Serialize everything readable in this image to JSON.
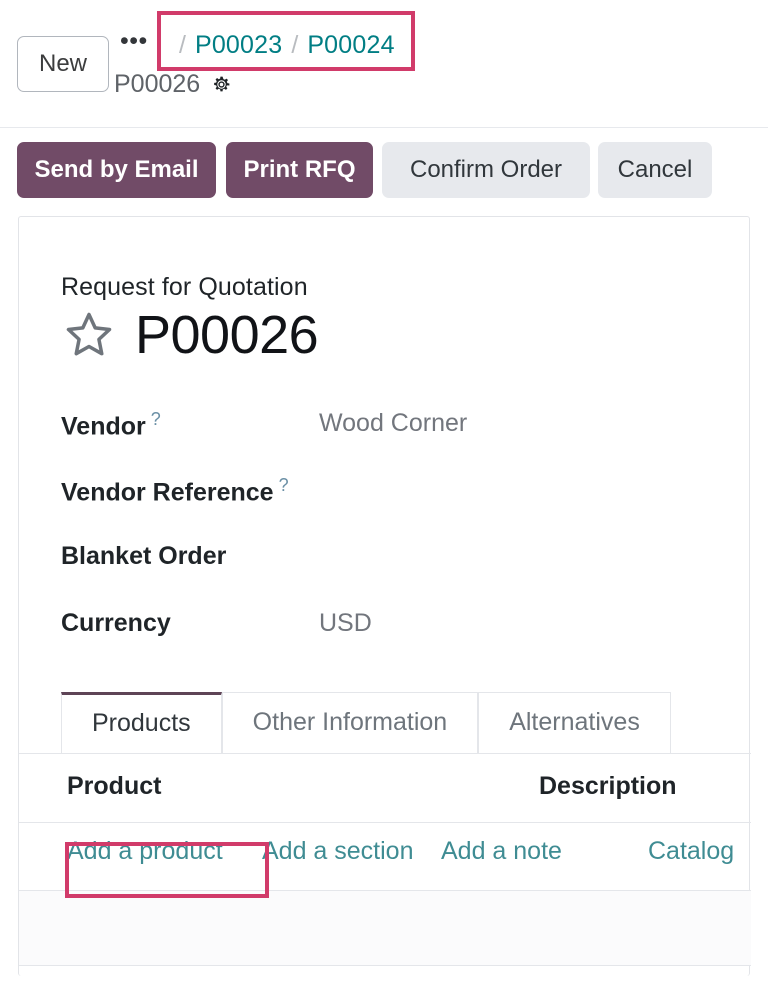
{
  "control_panel": {
    "new_button": "New",
    "more_button": "•••",
    "more_icon": "ellipsis-icon",
    "breadcrumb": {
      "separator": "/",
      "links": [
        {
          "label": "P00023"
        },
        {
          "label": "P00024"
        }
      ],
      "current": "P00026",
      "settings_icon": "gear-icon"
    }
  },
  "action_bar": {
    "buttons": [
      {
        "label": "Send by Email",
        "style": "primary"
      },
      {
        "label": "Print RFQ",
        "style": "primary"
      },
      {
        "label": "Confirm Order",
        "style": "secondary"
      },
      {
        "label": "Cancel",
        "style": "secondary"
      }
    ]
  },
  "form": {
    "subtitle": "Request for Quotation",
    "favorite_icon": "star-outline-icon",
    "title": "P00026",
    "fields": [
      {
        "label": "Vendor",
        "tooltip": "?",
        "value": "Wood Corner"
      },
      {
        "label": "Vendor Reference",
        "tooltip": "?",
        "value": ""
      },
      {
        "label": "Blanket Order",
        "tooltip": "",
        "value": ""
      },
      {
        "label": "Currency",
        "tooltip": "",
        "value": "USD"
      }
    ]
  },
  "notebook": {
    "tabs": [
      {
        "label": "Products",
        "active": true
      },
      {
        "label": "Other Information",
        "active": false
      },
      {
        "label": "Alternatives",
        "active": false
      }
    ]
  },
  "order_lines": {
    "columns": [
      {
        "label": "Product"
      },
      {
        "label": "Description"
      }
    ],
    "rows": [],
    "actions": [
      {
        "label": "Add a product"
      },
      {
        "label": "Add a section"
      },
      {
        "label": "Add a note"
      },
      {
        "label": "Catalog"
      }
    ]
  },
  "annotations": {
    "color": "#d13b6a",
    "targets": [
      {
        "name": "breadcrumb-links-highlight"
      },
      {
        "name": "add-a-product-highlight"
      }
    ]
  },
  "colors": {
    "brand_purple": "#714b67",
    "link_teal": "#017e84",
    "line_link_teal": "#3f8c93",
    "annotation_pink": "#d13b6a",
    "secondary_button": "#e7e9ed",
    "text_dark": "#1f2428",
    "text_muted": "#72767d"
  }
}
